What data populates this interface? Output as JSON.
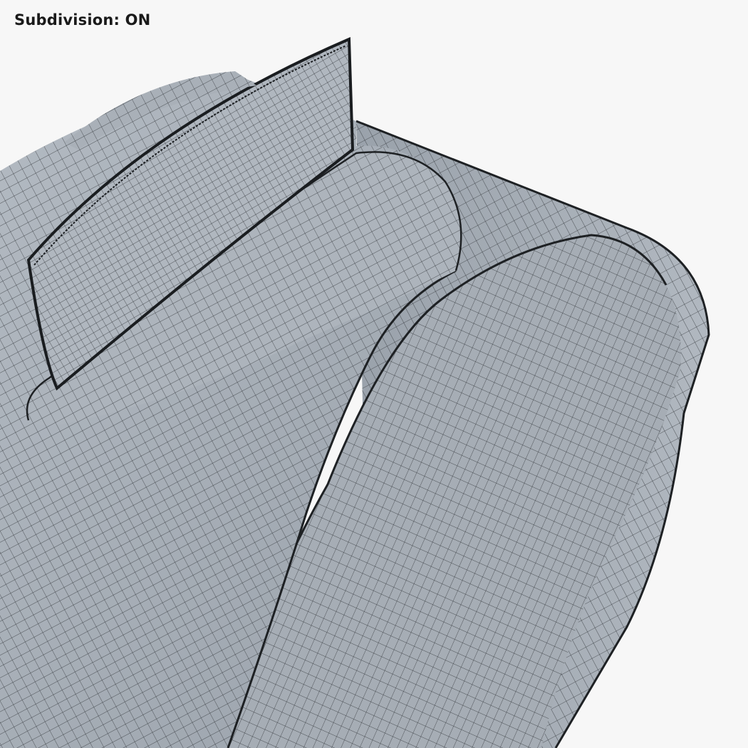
{
  "overlay": {
    "subdivision_label": "Subdivision: ON"
  },
  "render": {
    "subject": "backpack-handle-wireframe",
    "surface_color": "#a9b0b8",
    "surface_shadow_color": "#8e969f",
    "wire_color": "#2b2f33",
    "background_color": "#f7f7f7"
  }
}
